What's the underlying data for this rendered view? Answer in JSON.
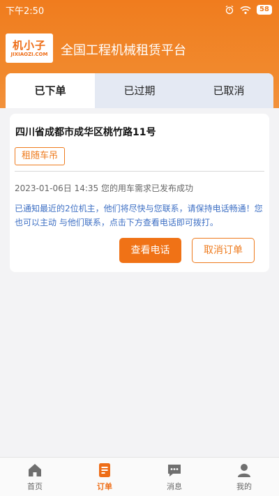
{
  "status_bar": {
    "time": "下午2:50",
    "battery": "58"
  },
  "header": {
    "logo_text": "机小子",
    "logo_sub": "JIXIAOZI.COM",
    "title": "全国工程机械租赁平台"
  },
  "tabs": [
    {
      "label": "已下单",
      "active": true
    },
    {
      "label": "已过期",
      "active": false
    },
    {
      "label": "已取消",
      "active": false
    }
  ],
  "order": {
    "address": "四川省成都市成华区桃竹路11号",
    "tag": "租随车吊",
    "status_line": "2023-01-06日 14:35 您的用车需求已发布成功",
    "message": "已通知最近的2位机主，他们将尽快与您联系，请保持电话畅通！您也可以主动 与他们联系，点击下方查看电话即可拨打。",
    "btn_phone": "查看电话",
    "btn_cancel": "取消订单"
  },
  "nav": [
    {
      "label": "首页",
      "icon": "home-icon"
    },
    {
      "label": "订单",
      "icon": "order-icon",
      "active": true
    },
    {
      "label": "消息",
      "icon": "message-icon"
    },
    {
      "label": "我的",
      "icon": "user-icon"
    }
  ],
  "colors": {
    "accent": "#f07216",
    "link": "#3d6fc4",
    "tab_bg": "#e4e9f3"
  }
}
